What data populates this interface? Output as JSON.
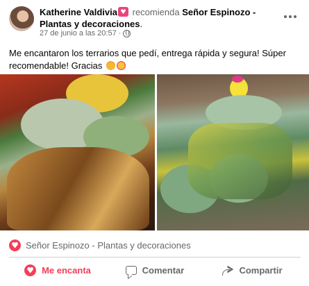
{
  "post": {
    "author": "Katherine Valdivia",
    "verb": "recomienda",
    "page_name": "Señor Espinozo - Plantas y decoraciones",
    "page_suffix": ".",
    "timestamp": "27 de junio a las 20:57",
    "separator": "·",
    "privacy_icon": "globe-icon",
    "body_text": "Me encantaron los terrarios que pedí, entrega rápida y segura! Súper recomendable! Gracias",
    "body_emojis": [
      "smiling-face-emoji",
      "smiling-face-with-hearts-emoji"
    ]
  },
  "photos": [
    {
      "icon": "terrarium-photo-1"
    },
    {
      "icon": "terrarium-photo-2"
    }
  ],
  "page_tag": {
    "label": "Señor Espinozo - Plantas y decoraciones",
    "icon": "heart-recommend-icon",
    "accent": "#f33e58"
  },
  "actions": {
    "like_label": "Me encanta",
    "comment_label": "Comentar",
    "share_label": "Compartir"
  },
  "colors": {
    "text": "#050505",
    "secondary": "#65676b",
    "love": "#f33e58",
    "divider": "#ced0d4"
  }
}
